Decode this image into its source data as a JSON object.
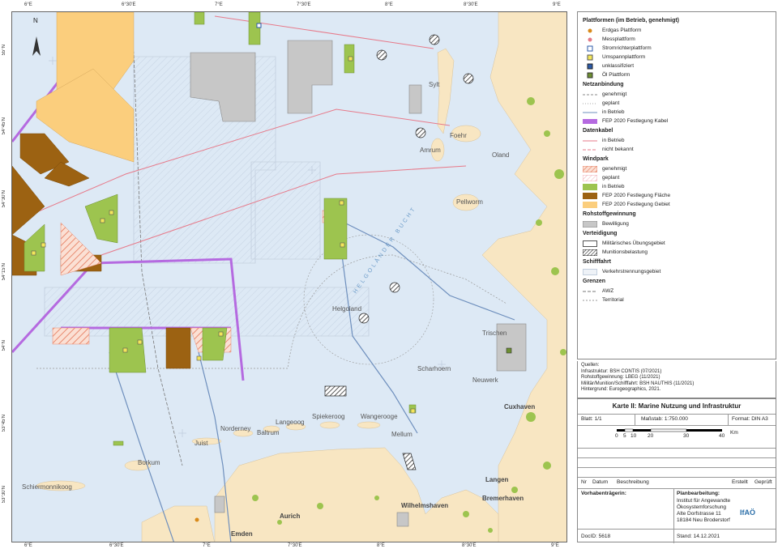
{
  "map": {
    "coords_top": [
      "6°E",
      "6°30'E",
      "7°E",
      "7°30'E",
      "8°E",
      "8°30'E",
      "9°E"
    ],
    "coords_bottom": [
      "6°E",
      "6°30'E",
      "7°E",
      "7°30'E",
      "8°E",
      "8°30'E",
      "9°E"
    ],
    "coords_left": [
      "55°N",
      "54°45'N",
      "54°30'N",
      "54°15'N",
      "54°N",
      "53°45'N",
      "53°30'N"
    ],
    "north_label": "N",
    "places": {
      "sylt": "Sylt",
      "foehr": "Foehr",
      "amrum": "Amrum",
      "oland": "Oland",
      "pellworm": "Pellworm",
      "helgoland": "Helgoland",
      "bight": "HELGOLÄNDER BUCHT",
      "trischen": "Trischen",
      "scharhoern": "Scharhoern",
      "neuwerk": "Neuwerk",
      "cuxhaven": "Cuxhaven",
      "norderney": "Norderney",
      "baltrum": "Baltrum",
      "langeoog": "Langeoog",
      "spiekeroog": "Spiekeroog",
      "wangerooge": "Wangerooge",
      "mellum": "Mellum",
      "juist": "Juist",
      "borkum": "Borkum",
      "schiermonnikoog": "Schiermonnikoog",
      "langen": "Langen",
      "bremerhaven": "Bremerhaven",
      "wilhelmshaven": "Wilhelmshaven",
      "aurich": "Aurich",
      "emden": "Emden"
    }
  },
  "legend": {
    "platforms_title": "Plattformen (im Betrieb, genehmigt)",
    "platforms": [
      "Erdgas Plattform",
      "Messplattform",
      "Stromrichterplattform",
      "Umspannplattform",
      "unklassifiziert",
      "Öl Plattform"
    ],
    "grid_title": "Netzanbindung",
    "grid": [
      "genehmigt",
      "geplant",
      "in Betrieb",
      "FEP 2020 Festlegung Kabel"
    ],
    "data_title": "Datenkabel",
    "data": [
      "in Betrieb",
      "nicht bekannt"
    ],
    "wind_title": "Windpark",
    "wind": [
      "genehmigt",
      "geplant",
      "in Betrieb",
      "FEP 2020 Festlegung Fläche",
      "FEP 2020 Festlegung Gebiet"
    ],
    "raw_title": "Rohstoffgewinnung",
    "raw": [
      "Bewilligung"
    ],
    "def_title": "Verteidigung",
    "def": [
      "Militärisches Übungsgebiet",
      "Munitionsbelastung"
    ],
    "ship_title": "Schifffahrt",
    "ship": [
      "Verkehrstrennungsgebiet"
    ],
    "border_title": "Grenzen",
    "border": [
      "AWZ",
      "Territorial"
    ]
  },
  "sources": {
    "title": "Quellen:",
    "lines": [
      "Infrastruktur: BSH CONTIS (07/2021)",
      "Rohstoffgewinnung: LBEG (11/2021)",
      "Militär/Munition/Schifffahrt: BSH NAUTHIS (11/2021)",
      "Hintergrund: Eurogeographics, 2021."
    ]
  },
  "titleblock": {
    "title": "Karte II: Marine Nutzung und Infrastruktur",
    "sheet": "Blatt: 1/1",
    "scale": "Maßstab: 1:750.000",
    "format": "Format: DIN A3",
    "scale_ticks": [
      "0",
      "5",
      "10",
      "20",
      "30",
      "40"
    ],
    "scale_unit": "Km",
    "rev_nr": "Nr",
    "rev_date": "Datum",
    "rev_desc": "Beschreibung",
    "rev_created": "Erstellt",
    "rev_checked": "Geprüft",
    "client_label": "Vorhabenträgerin:",
    "processing_label": "Planbearbeitung:",
    "processing_lines": [
      "Institut für Angewandte",
      "Ökosystemforschung",
      "Alte Dorfstrasse 11",
      "18184 Neu Broderstorf"
    ],
    "logo_text": "IfAÖ",
    "docid": "DocID: 5618",
    "date": "Stand: 14.12.2021"
  },
  "colors": {
    "sea": "#dde9f5",
    "land": "#f8e6c2",
    "green": "#9dc44f",
    "brown": "#9c6212",
    "orange": "#fbce7d",
    "grey": "#c7c7c7",
    "cable_purple": "#b56ae0",
    "data_red": "#e77a8a",
    "grid_blue": "#6e8fbd"
  }
}
